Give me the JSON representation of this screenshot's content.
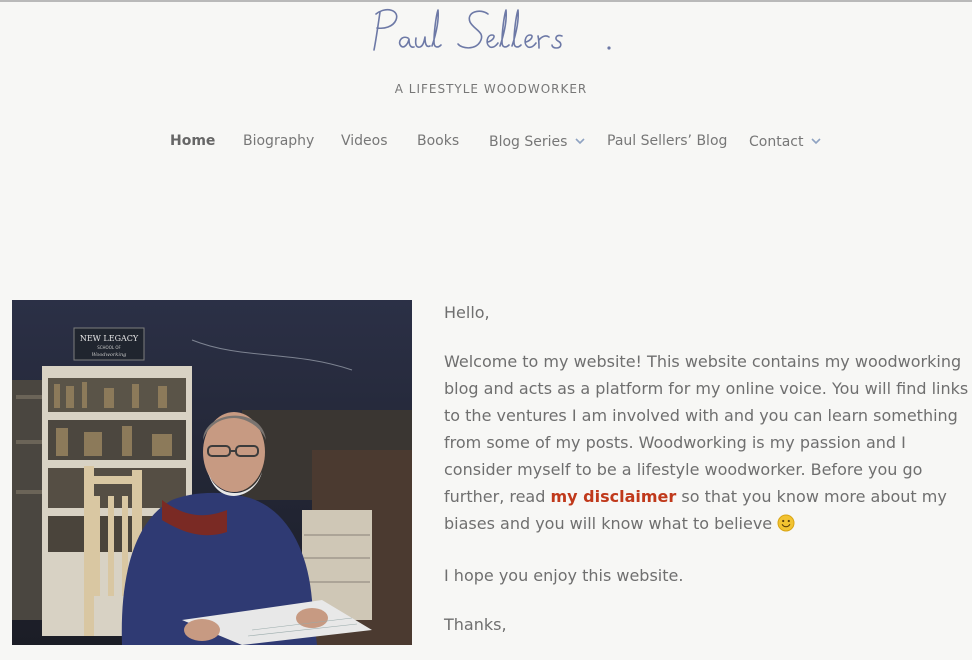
{
  "site": {
    "logo_text": "Paul Sellers.",
    "tagline": "A LIFESTYLE WOODWORKER"
  },
  "nav": {
    "items": [
      {
        "label": "Home",
        "active": true,
        "has_dropdown": false
      },
      {
        "label": "Biography",
        "active": false,
        "has_dropdown": false
      },
      {
        "label": "Videos",
        "active": false,
        "has_dropdown": false
      },
      {
        "label": "Books",
        "active": false,
        "has_dropdown": false
      },
      {
        "label": "Blog Series",
        "active": false,
        "has_dropdown": true
      },
      {
        "label": "Paul Sellers’ Blog",
        "active": false,
        "has_dropdown": false
      },
      {
        "label": "Contact",
        "active": false,
        "has_dropdown": true
      }
    ],
    "dropdown_icon": "chevron-down-icon"
  },
  "hero_image": {
    "sign_line_1": "NEW LEGACY",
    "sign_line_2": "SCHOOL OF",
    "sign_line_3": "Woodworking"
  },
  "content": {
    "greeting": "Hello,",
    "intro_before_link": "Welcome to my website! This website contains my woodworking blog and acts as a platform for my online voice. You will find links to the ventures I am involved with and you can learn something from some of my posts. Woodworking is my passion and I consider myself to be a lifestyle woodworker. Before you go further, read ",
    "disclaimer_link": "my disclaimer",
    "intro_after_link": " so that you know more about my biases and you will know what to believe",
    "emoji_icon": "smiley-face-icon",
    "closing_line": "I hope you enjoy this website.",
    "signoff": "Thanks,"
  },
  "colors": {
    "background": "#f7f7f5",
    "logo": "#6d79a6",
    "link": "#c0391b",
    "text": "#6f6f6f",
    "chevron": "#8fa3c2"
  }
}
